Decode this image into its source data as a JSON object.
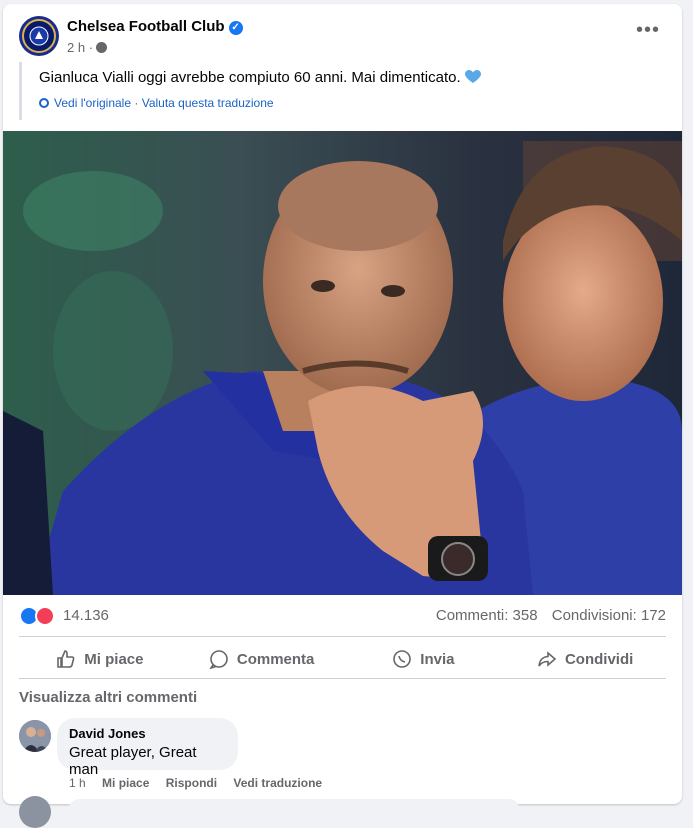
{
  "post": {
    "page_name": "Chelsea Football Club",
    "timestamp": "2 h",
    "text": "Gianluca Vialli oggi avrebbe compiuto 60 anni. Mai dimenticato.",
    "translation": {
      "see_original": "Vedi l'originale",
      "separator": "·",
      "rate_translation": "Valuta questa traduzione"
    }
  },
  "stats": {
    "reactions_count": "14.136",
    "comments": "Commenti: 358",
    "shares": "Condivisioni: 172"
  },
  "actions": {
    "like": "Mi piace",
    "comment": "Commenta",
    "send": "Invia",
    "share": "Condividi"
  },
  "comments_section": {
    "view_more": "Visualizza altri commenti",
    "items": [
      {
        "author": "David Jones",
        "text": "Great player, Great man",
        "time": "1 h",
        "like": "Mi piace",
        "reply": "Rispondi",
        "see_translation": "Vedi traduzione"
      }
    ]
  },
  "colors": {
    "brand_blue": "#1877f2",
    "love_red": "#f33e58",
    "chelsea_blue": "#1a2a8e",
    "link_blue": "#1a63c7"
  },
  "icons": {
    "verified": "verified-badge-icon",
    "audience": "globe-icon",
    "more": "more-horizontal-icon",
    "heart": "blue-heart-icon"
  }
}
